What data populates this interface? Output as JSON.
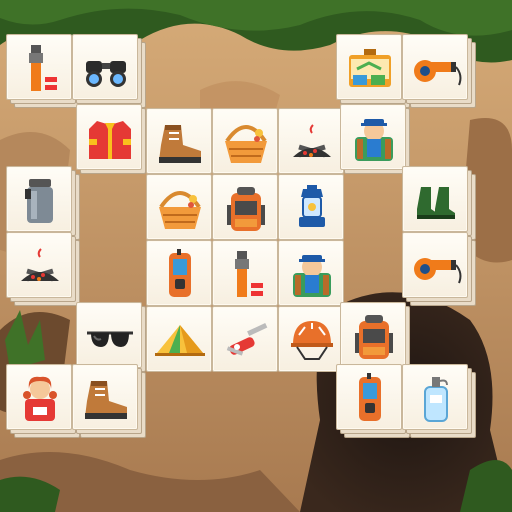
{
  "game": {
    "colors": {
      "sky": "#3c5f2a",
      "cave_wall": "#c79a6b",
      "cave_shadow": "#6c4a2e",
      "cave_dark": "#2a1e17",
      "foliage": "#2f5a1f",
      "tile_face": "#fbf6ec",
      "tile_edge": "#c9b79b"
    },
    "tiles": [
      {
        "icon": "flashlight-icon",
        "layers": 3,
        "col": 0,
        "row": 0
      },
      {
        "icon": "binoculars-icon",
        "layers": 3,
        "col": 1,
        "row": 0
      },
      {
        "icon": "toolbox-icon",
        "layers": 3,
        "col": 5,
        "row": 0
      },
      {
        "icon": "whistle-icon",
        "layers": 3,
        "col": 6,
        "row": 0
      },
      {
        "icon": "jacket-icon",
        "layers": 2,
        "col": 1,
        "row": 1
      },
      {
        "icon": "hiking-boot-icon",
        "layers": 1,
        "col": 2,
        "row": 1
      },
      {
        "icon": "basket-icon",
        "layers": 1,
        "col": 3,
        "row": 1
      },
      {
        "icon": "campfire-icon",
        "layers": 1,
        "col": 4,
        "row": 1
      },
      {
        "icon": "hiker-icon",
        "layers": 2,
        "col": 5,
        "row": 1
      },
      {
        "icon": "thermos-icon",
        "layers": 3,
        "col": 0,
        "row": 2
      },
      {
        "icon": "basket-icon",
        "layers": 1,
        "col": 2,
        "row": 2
      },
      {
        "icon": "backpack-icon",
        "layers": 1,
        "col": 3,
        "row": 2
      },
      {
        "icon": "lantern-icon",
        "layers": 1,
        "col": 4,
        "row": 2
      },
      {
        "icon": "rubber-boots-icon",
        "layers": 3,
        "col": 6,
        "row": 2
      },
      {
        "icon": "campfire-icon",
        "layers": 3,
        "col": 0,
        "row": 3
      },
      {
        "icon": "gps-device-icon",
        "layers": 1,
        "col": 2,
        "row": 3
      },
      {
        "icon": "flashlight-icon",
        "layers": 1,
        "col": 3,
        "row": 3
      },
      {
        "icon": "hiker-icon",
        "layers": 1,
        "col": 4,
        "row": 3
      },
      {
        "icon": "whistle-icon",
        "layers": 3,
        "col": 6,
        "row": 3
      },
      {
        "icon": "sunglasses-icon",
        "layers": 2,
        "col": 1,
        "row": 4
      },
      {
        "icon": "tent-icon",
        "layers": 1,
        "col": 2,
        "row": 4
      },
      {
        "icon": "pocket-knife-icon",
        "layers": 1,
        "col": 3,
        "row": 4
      },
      {
        "icon": "helmet-icon",
        "layers": 1,
        "col": 4,
        "row": 4
      },
      {
        "icon": "backpack-icon",
        "layers": 2,
        "col": 5,
        "row": 4
      },
      {
        "icon": "girl-scout-icon",
        "layers": 3,
        "col": 0,
        "row": 5
      },
      {
        "icon": "hiking-boot-icon",
        "layers": 3,
        "col": 1,
        "row": 5
      },
      {
        "icon": "gps-device-icon",
        "layers": 3,
        "col": 5,
        "row": 5
      },
      {
        "icon": "gas-canister-icon",
        "layers": 3,
        "col": 6,
        "row": 5
      }
    ]
  }
}
